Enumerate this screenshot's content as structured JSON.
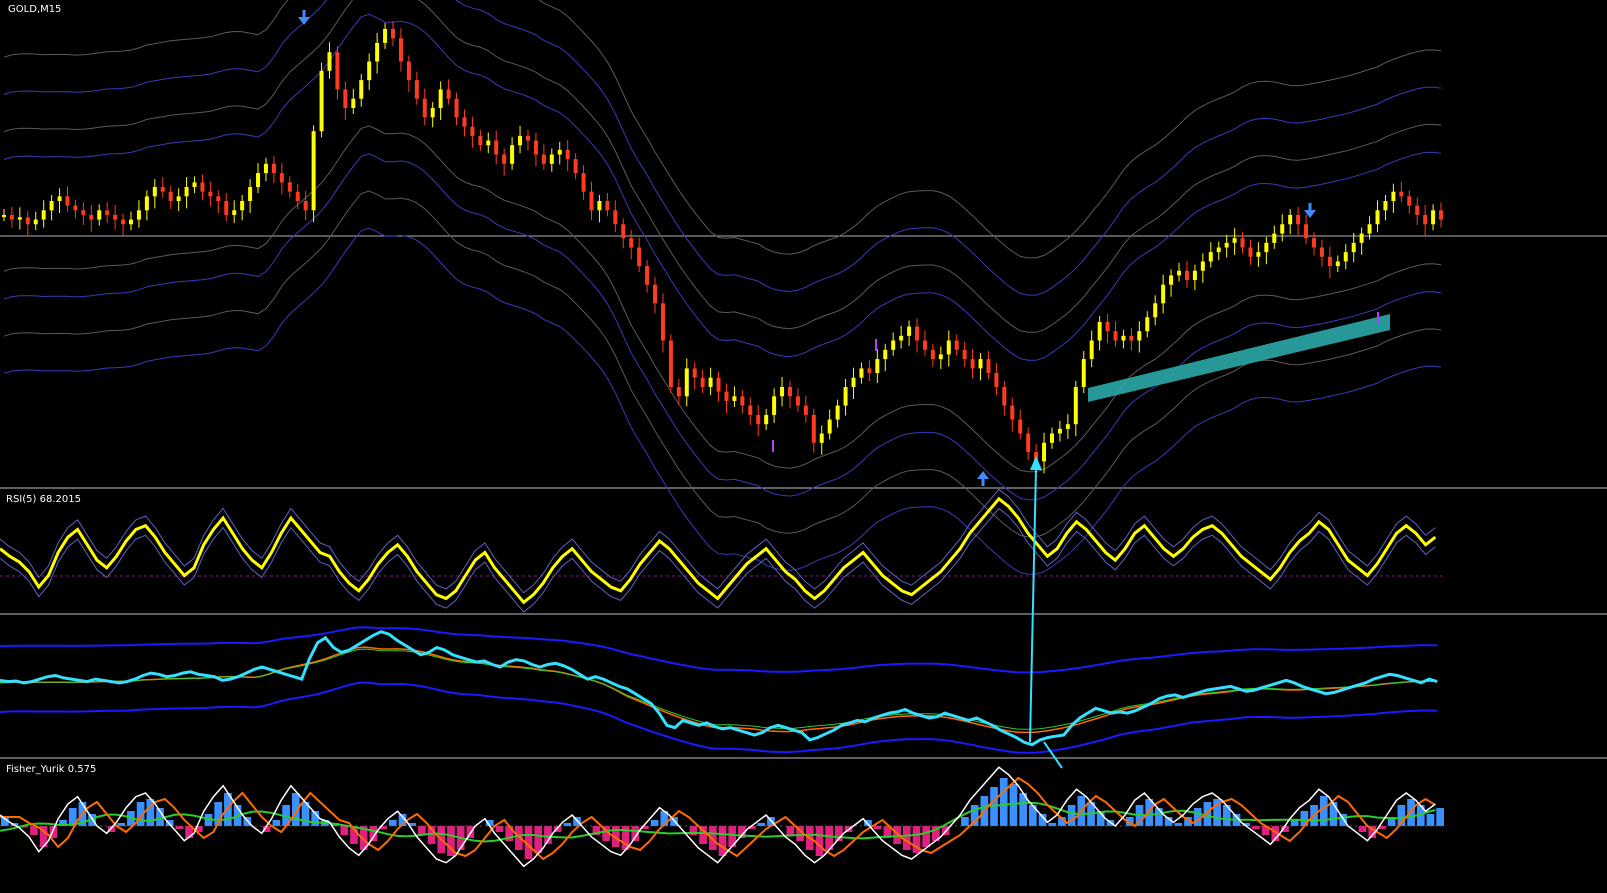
{
  "header": {
    "symbol_label": "GOLD,M15"
  },
  "panes": {
    "rsi_label": "RSI(5) 68.2015",
    "fisher_label": "Fisher_Yurik 0.575"
  },
  "colors": {
    "background": "#000000",
    "candle_up": "#ffff00",
    "candle_down": "#ff3b1f",
    "band_blue": "#3a3ab8",
    "band_gray": "#5a5a5a",
    "signal_arrow": "#3f8cff",
    "pivot_marker": "#b040ff",
    "highlight_band": "#2aa8a8",
    "cyan_line": "#35e0ff",
    "rsi_line": "#ffff00",
    "histogram_pos": "#3a90ff",
    "histogram_neg": "#e0207f",
    "fisher_white": "#ffffff",
    "fisher_orange": "#ff6a00",
    "fisher_green": "#2ccc2c",
    "separator": "#bfbfbf"
  },
  "chart_data": [
    {
      "type": "candlestick",
      "symbol": "GOLD",
      "timeframe": "M15",
      "series": [
        {
          "name": "price",
          "values": [
            0.57,
            0.56,
            0.565,
            0.55,
            0.56,
            0.58,
            0.6,
            0.61,
            0.59,
            0.58,
            0.57,
            0.56,
            0.58,
            0.57,
            0.56,
            0.55,
            0.56,
            0.58,
            0.61,
            0.63,
            0.62,
            0.6,
            0.61,
            0.63,
            0.64,
            0.62,
            0.61,
            0.6,
            0.57,
            0.58,
            0.6,
            0.63,
            0.66,
            0.68,
            0.66,
            0.64,
            0.62,
            0.6,
            0.58,
            0.75,
            0.88,
            0.92,
            0.84,
            0.8,
            0.82,
            0.86,
            0.9,
            0.94,
            0.97,
            0.95,
            0.9,
            0.86,
            0.82,
            0.78,
            0.8,
            0.84,
            0.82,
            0.78,
            0.76,
            0.74,
            0.72,
            0.73,
            0.7,
            0.68,
            0.72,
            0.74,
            0.73,
            0.7,
            0.68,
            0.7,
            0.71,
            0.69,
            0.66,
            0.62,
            0.58,
            0.6,
            0.58,
            0.55,
            0.52,
            0.5,
            0.46,
            0.42,
            0.38,
            0.3,
            0.2,
            0.18,
            0.24,
            0.22,
            0.2,
            0.22,
            0.19,
            0.17,
            0.18,
            0.16,
            0.14,
            0.12,
            0.14,
            0.18,
            0.2,
            0.18,
            0.16,
            0.14,
            0.08,
            0.1,
            0.13,
            0.16,
            0.2,
            0.22,
            0.24,
            0.23,
            0.26,
            0.28,
            0.3,
            0.31,
            0.33,
            0.3,
            0.28,
            0.26,
            0.27,
            0.3,
            0.28,
            0.26,
            0.24,
            0.26,
            0.23,
            0.2,
            0.16,
            0.13,
            0.1,
            0.06,
            0.04,
            0.08,
            0.1,
            0.11,
            0.12,
            0.2,
            0.26,
            0.3,
            0.34,
            0.32,
            0.3,
            0.31,
            0.3,
            0.32,
            0.35,
            0.38,
            0.42,
            0.44,
            0.45,
            0.43,
            0.45,
            0.47,
            0.49,
            0.5,
            0.51,
            0.52,
            0.5,
            0.48,
            0.49,
            0.51,
            0.53,
            0.55,
            0.57,
            0.55,
            0.52,
            0.5,
            0.48,
            0.46,
            0.47,
            0.49,
            0.51,
            0.53,
            0.55,
            0.58,
            0.6,
            0.62,
            0.61,
            0.59,
            0.57,
            0.55,
            0.58,
            0.56
          ]
        },
        {
          "name": "RSI(5)",
          "values": [
            62,
            58,
            55,
            50,
            42,
            48,
            60,
            68,
            72,
            64,
            56,
            52,
            58,
            66,
            72,
            74,
            68,
            60,
            54,
            48,
            52,
            64,
            72,
            78,
            70,
            62,
            56,
            52,
            60,
            70,
            78,
            72,
            66,
            60,
            58,
            50,
            44,
            40,
            46,
            54,
            60,
            64,
            58,
            50,
            44,
            38,
            36,
            40,
            48,
            56,
            60,
            52,
            46,
            40,
            34,
            38,
            44,
            52,
            58,
            62,
            56,
            50,
            46,
            42,
            40,
            46,
            54,
            60,
            66,
            62,
            56,
            50,
            44,
            40,
            36,
            42,
            48,
            54,
            58,
            62,
            56,
            50,
            46,
            40,
            36,
            40,
            46,
            52,
            56,
            60,
            54,
            48,
            44,
            40,
            38,
            42,
            46,
            50,
            56,
            62,
            70,
            76,
            82,
            88,
            84,
            78,
            70,
            64,
            58,
            62,
            70,
            76,
            72,
            66,
            60,
            56,
            62,
            70,
            74,
            68,
            62,
            58,
            62,
            68,
            72,
            74,
            70,
            64,
            58,
            54,
            50,
            46,
            52,
            60,
            66,
            70,
            76,
            72,
            64,
            56,
            52,
            48,
            54,
            62,
            70,
            74,
            70,
            64,
            68
          ]
        }
      ],
      "annotations": [
        {
          "type": "arrow_down",
          "label": "signal-sell-1"
        },
        {
          "type": "arrow_up",
          "label": "signal-buy-1"
        },
        {
          "type": "arrow_down",
          "label": "signal-sell-2"
        },
        {
          "type": "highlight_band",
          "label": "uptrend-highlight"
        }
      ]
    }
  ]
}
